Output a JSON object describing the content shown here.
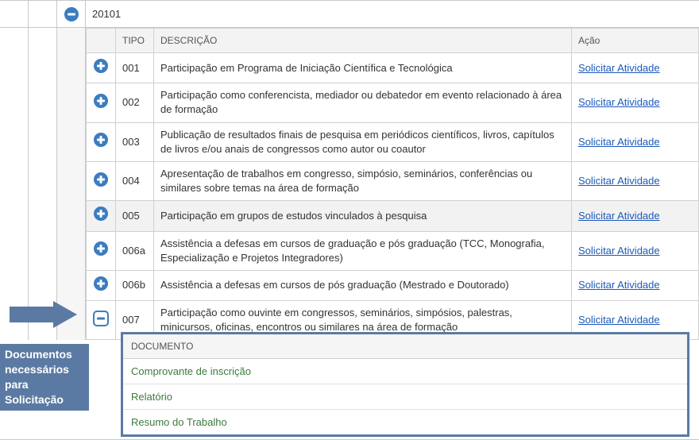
{
  "period": "20101",
  "table": {
    "headers": {
      "tipo": "TIPO",
      "descricao": "DESCRIÇÃO",
      "acao": "Ação"
    },
    "action_label": "Solicitar Atividade",
    "rows": [
      {
        "tipo": "001",
        "descricao": "Participação em Programa de Iniciação Científica e Tecnológica",
        "expanded": false,
        "highlight": false
      },
      {
        "tipo": "002",
        "descricao": "Participação como conferencista, mediador ou debatedor em evento relacionado à área de formação",
        "expanded": false,
        "highlight": false
      },
      {
        "tipo": "003",
        "descricao": "Publicação de resultados finais de pesquisa em periódicos científicos, livros, capítulos de livros e/ou anais de congressos como autor ou coautor",
        "expanded": false,
        "highlight": false
      },
      {
        "tipo": "004",
        "descricao": "Apresentação de trabalhos em congresso, simpósio, seminários, conferências ou similares sobre temas na área de formação",
        "expanded": false,
        "highlight": false
      },
      {
        "tipo": "005",
        "descricao": "Participação em grupos de estudos vinculados à pesquisa",
        "expanded": false,
        "highlight": true
      },
      {
        "tipo": "006a",
        "descricao": "Assistência a defesas em cursos de graduação e pós graduação (TCC, Monografia, Especialização e Projetos Integradores)",
        "expanded": false,
        "highlight": false
      },
      {
        "tipo": "006b",
        "descricao": "Assistência a defesas em cursos de pós graduação (Mestrado e Doutorado)",
        "expanded": false,
        "highlight": false
      },
      {
        "tipo": "007",
        "descricao": "Participação como ouvinte em congressos, seminários, simpósios, palestras, minicursos, oficinas, encontros ou similares na área de formação",
        "expanded": true,
        "highlight": false
      }
    ]
  },
  "arrow_caption": "Documentos necessários para Solicitação",
  "documents": {
    "header": "DOCUMENTO",
    "items": [
      "Comprovante de inscrição",
      "Relatório",
      "Resumo do Trabalho"
    ]
  }
}
